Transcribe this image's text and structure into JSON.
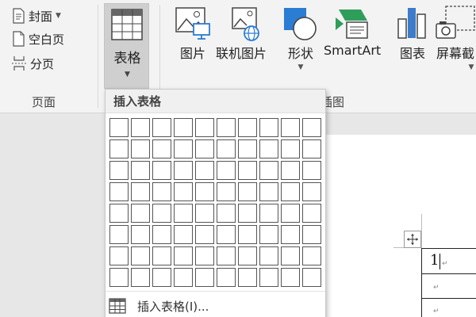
{
  "ribbon": {
    "pages_group": {
      "cover_label": "封面",
      "blank_page_label": "空白页",
      "page_break_label": "分页",
      "group_label": "页面"
    },
    "table_label": "表格",
    "pictures_label": "图片",
    "online_pictures_label": "联机图片",
    "shapes_label": "形状",
    "smartart_label": "SmartArt",
    "chart_label": "图表",
    "screenshot_label": "屏幕截",
    "illustrations_group_label_partial": "插图"
  },
  "dropdown": {
    "header": "插入表格",
    "grid_rows": 8,
    "grid_cols": 10,
    "insert_table_label": "插入表格(I)..."
  },
  "document": {
    "cell_text": "1",
    "para_mark": "↵"
  },
  "colors": {
    "shapes_blue": "#2b7cd3",
    "smartart_green": "#2e9e5b",
    "chart_blue": "#3d7cc9"
  }
}
